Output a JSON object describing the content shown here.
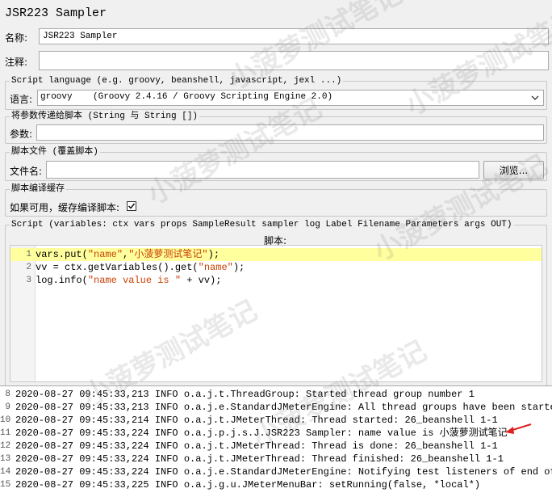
{
  "window_title": "JSR223 Sampler",
  "name_label": "名称:",
  "name_value": "JSR223 Sampler",
  "comment_label": "注释:",
  "comment_value": "",
  "script_language": {
    "legend": "Script language (e.g. groovy, beanshell, javascript, jexl ...)",
    "label": "语言:",
    "selected_id": "groovy",
    "selected_desc": "(Groovy 2.4.16 / Groovy Scripting Engine 2.0)"
  },
  "params": {
    "legend": "将参数传递给脚本 (String 与 String [])",
    "label": "参数:",
    "value": ""
  },
  "script_file": {
    "legend": "脚本文件 (覆盖脚本)",
    "label": "文件名:",
    "value": "",
    "browse_label": "浏览..."
  },
  "cache": {
    "legend": "脚本编译缓存",
    "label": "如果可用，缓存编译脚本:",
    "checked": true
  },
  "script": {
    "legend": "Script (variables: ctx vars props SampleResult sampler log Label Filename Parameters args OUT)",
    "header": "脚本:",
    "lines": [
      {
        "n": "1",
        "parts": [
          [
            "vars.put(",
            ""
          ],
          [
            "\"name\"",
            "s"
          ],
          [
            ",",
            ""
          ],
          [
            "\"小菠萝测试笔记\"",
            "s"
          ],
          [
            ");",
            ""
          ]
        ]
      },
      {
        "n": "2",
        "parts": [
          [
            "vv = ctx.getVariables().get(",
            ""
          ],
          [
            "\"name\"",
            "s"
          ],
          [
            ");",
            ""
          ]
        ]
      },
      {
        "n": "3",
        "parts": [
          [
            "log.info(",
            ""
          ],
          [
            "\"name value is \"",
            "s"
          ],
          [
            " + vv);",
            ""
          ]
        ]
      }
    ]
  },
  "log": {
    "lines": [
      {
        "n": "8",
        "text": "2020-08-27 09:45:33,213 INFO o.a.j.t.ThreadGroup: Started thread group number 1"
      },
      {
        "n": "9",
        "text": "2020-08-27 09:45:33,213 INFO o.a.j.e.StandardJMeterEngine: All thread groups have been started"
      },
      {
        "n": "10",
        "text": "2020-08-27 09:45:33,214 INFO o.a.j.t.JMeterThread: Thread started: 26_beanshell 1-1"
      },
      {
        "n": "11",
        "text": "2020-08-27 09:45:33,224 INFO o.a.j.p.j.s.J.JSR223 Sampler: name value is 小菠萝测试笔记"
      },
      {
        "n": "12",
        "text": "2020-08-27 09:45:33,224 INFO o.a.j.t.JMeterThread: Thread is done: 26_beanshell 1-1"
      },
      {
        "n": "13",
        "text": "2020-08-27 09:45:33,224 INFO o.a.j.t.JMeterThread: Thread finished: 26_beanshell 1-1"
      },
      {
        "n": "14",
        "text": "2020-08-27 09:45:33,224 INFO o.a.j.e.StandardJMeterEngine: Notifying test listeners of end of t"
      },
      {
        "n": "15",
        "text": "2020-08-27 09:45:33,225 INFO o.a.j.g.u.JMeterMenuBar: setRunning(false, *local*)"
      }
    ]
  },
  "watermark": "小菠萝测试笔记",
  "colors": {
    "string": "#c93f00",
    "highlight": "#ffff9e",
    "arrow": "#e02020"
  },
  "icons": {
    "dropdown": "chevron-down-icon",
    "arrow": "red-arrow-icon"
  }
}
